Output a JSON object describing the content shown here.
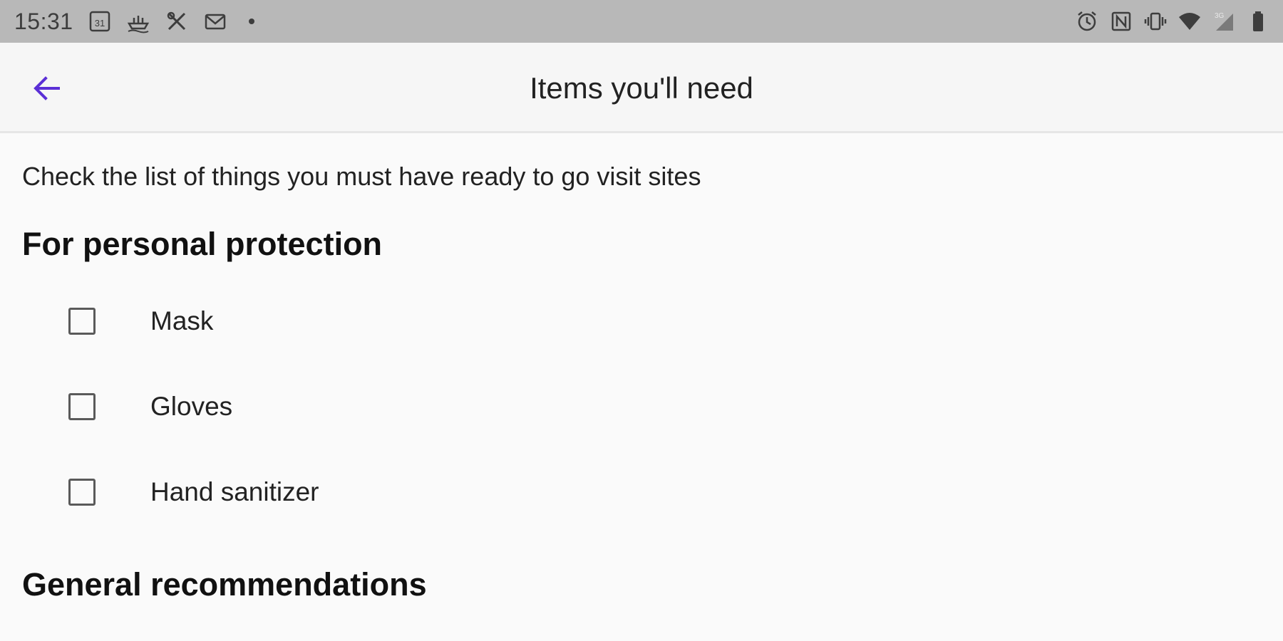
{
  "status_bar": {
    "time": "15:31",
    "left_icons": [
      "calendar-icon",
      "boat-icon",
      "tools-icon",
      "mail-icon",
      "notification-dot-icon"
    ],
    "calendar_day": "31",
    "right_icons": [
      "alarm-icon",
      "nfc-icon",
      "vibrate-icon",
      "wifi-icon",
      "signal-icon",
      "battery-icon"
    ],
    "network_type": "3G"
  },
  "app_bar": {
    "title": "Items you'll need",
    "back_icon": "arrow-back-icon",
    "accent_color": "#5b2fd6"
  },
  "content": {
    "intro": "Check the list of things you must have ready to go visit sites",
    "sections": [
      {
        "title": "For personal protection",
        "items": [
          {
            "label": "Mask",
            "checked": false
          },
          {
            "label": "Gloves",
            "checked": false
          },
          {
            "label": "Hand sanitizer",
            "checked": false
          }
        ]
      },
      {
        "title": "General recommendations",
        "items": []
      }
    ]
  }
}
